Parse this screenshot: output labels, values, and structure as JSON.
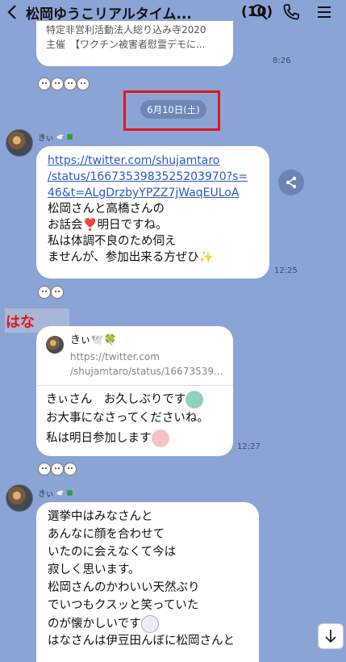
{
  "header": {
    "title": "松岡ゆうこリアルタイム...",
    "count": "(10)"
  },
  "top_bubble": {
    "line1": "特定非営利活動法人総り込み寺2020",
    "line2": "主催　【ワクチン被害者慰霊デモに...",
    "time": "8:26"
  },
  "date_separator": "6月10日(土)",
  "msg1": {
    "sender": "きぃ",
    "link_lines": [
      "https://twitter.com/shujamtaro",
      "/status/1667353983525203970?s=",
      "46&t=ALgDrzbyYPZZ7jWaqEULoA"
    ],
    "text_lines": [
      "松岡さんと高橋さんの",
      "お話会❣️明日ですね。",
      "私は体調不良のため伺え",
      "ませんが、参加出来る方ぜひ✨"
    ],
    "time": "12:25"
  },
  "msg2": {
    "sender": "はな",
    "quote_name": "きぃ🕊️🍀",
    "quote_url1": "https://twitter.com",
    "quote_url2": "/shujamtaro/status/16673539...",
    "text_lines": [
      "きぃさん　お久しぶりです",
      "お大事になさってくださいね。",
      "私は明日参加します"
    ],
    "time": "12:27"
  },
  "msg3": {
    "sender": "きぃ",
    "text_lines": [
      "選挙中はみなさんと",
      "あんなに顔を合わせて",
      "いたのに会えなくて今は",
      "寂しく思います。",
      "松岡さんのかわいい天然ぶり",
      "でいつもクスッと笑っていた",
      "のが懐かしいです",
      "はなさんは伊豆田んぼに松岡さんと"
    ]
  },
  "colors": {
    "background": "#8aa4d6",
    "highlight_box": "#e01818",
    "link": "#2e58c8"
  }
}
